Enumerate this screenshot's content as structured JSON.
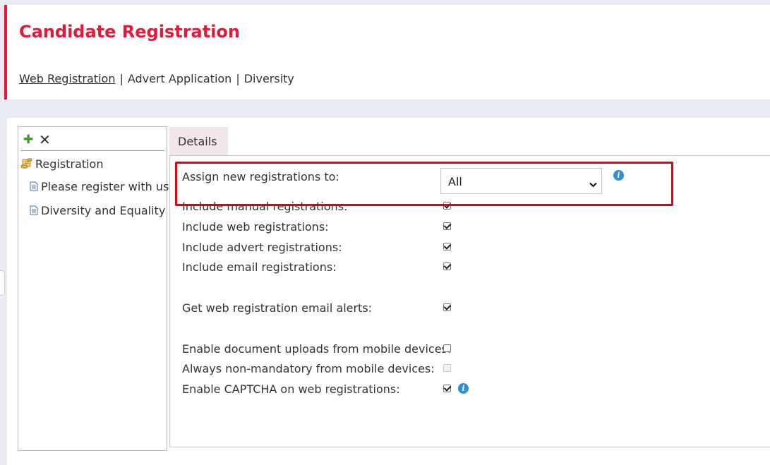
{
  "page": {
    "title": "Candidate Registration",
    "accent_color": "#e31937"
  },
  "subnav": {
    "links": [
      "Web Registration",
      "Advert Application",
      "Diversity"
    ],
    "active": "Web Registration",
    "separator": "|"
  },
  "tree": {
    "toolbar": {
      "add_icon": "plus-icon",
      "add_glyph": "✚",
      "delete_icon": "close-icon",
      "delete_glyph": "✕"
    },
    "root": {
      "label": "Registration",
      "icon": "scroll-icon"
    },
    "children": [
      {
        "label": "Please register with us",
        "icon": "document-icon"
      },
      {
        "label": "Diversity and Equality",
        "icon": "document-icon"
      }
    ]
  },
  "tabs": [
    {
      "label": "Details"
    }
  ],
  "details": {
    "assign": {
      "label": "Assign new registrations to:",
      "selected": "All",
      "chevron": "⌄"
    },
    "include_manual": {
      "label": "Include manual registrations:",
      "checked": true
    },
    "include_web": {
      "label": "Include web registrations:",
      "checked": true
    },
    "include_advert": {
      "label": "Include advert registrations:",
      "checked": true
    },
    "include_email": {
      "label": "Include email registrations:",
      "checked": true
    },
    "email_alerts": {
      "label": "Get web registration email alerts:",
      "checked": true
    },
    "mobile_uploads": {
      "label": "Enable document uploads from mobile devices:",
      "checked": false
    },
    "non_mandatory": {
      "label": "Always non-mandatory from mobile devices:",
      "checked": false,
      "disabled": true
    },
    "captcha": {
      "label": "Enable CAPTCHA on web registrations:",
      "checked": true
    },
    "info_glyph": "i"
  },
  "colors": {
    "highlight": "#e3000f",
    "info": "#2f8fd6",
    "tab_bg": "#f1e6e8",
    "add_green": "#3c9c2b"
  }
}
